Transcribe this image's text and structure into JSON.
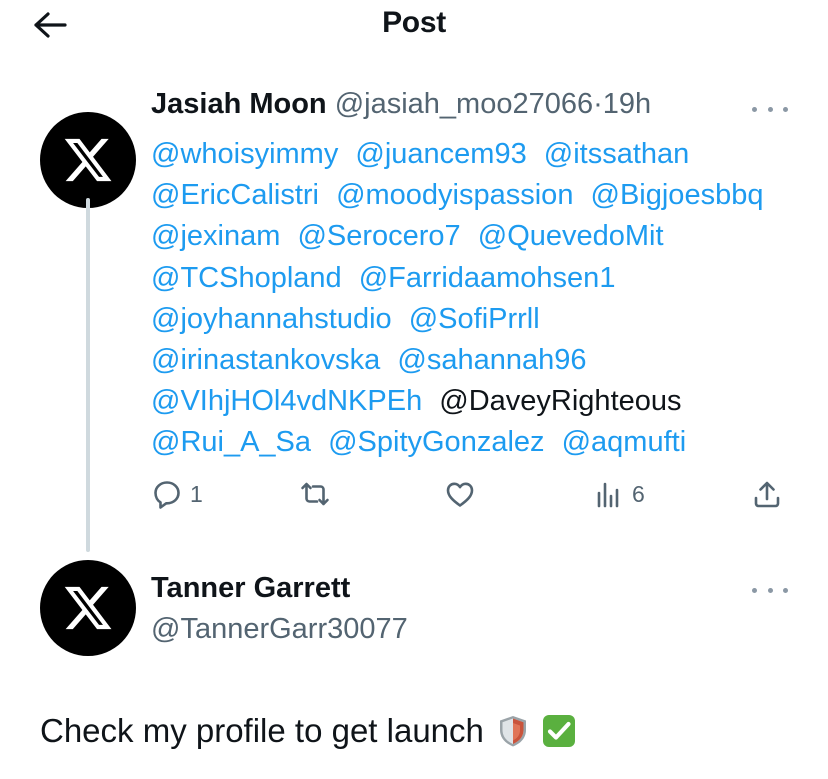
{
  "header": {
    "title": "Post",
    "back_icon": "arrow-left-icon"
  },
  "tweet1": {
    "avatar_icon": "x-logo-icon",
    "name": "Jasiah Moon",
    "handle": "@jasiah_moo27066",
    "separator": "·",
    "time": "19h",
    "more_icon": "more-icon",
    "mentions": [
      {
        "text": "@whoisyimmy",
        "linked": true
      },
      {
        "text": "@juancem93",
        "linked": true
      },
      {
        "text": "@itssathan",
        "linked": true
      },
      {
        "text": "@EricCalistri",
        "linked": true
      },
      {
        "text": "@moodyispassion",
        "linked": true
      },
      {
        "text": "@Bigjoesbbq",
        "linked": true
      },
      {
        "text": "@jexinam",
        "linked": true
      },
      {
        "text": "@Serocero7",
        "linked": true
      },
      {
        "text": "@QuevedoMit",
        "linked": true
      },
      {
        "text": "@TCShopland",
        "linked": true
      },
      {
        "text": "@Farridaamohsen1",
        "linked": true
      },
      {
        "text": "@joyhannahstudio",
        "linked": true
      },
      {
        "text": "@SofiPrrll",
        "linked": true
      },
      {
        "text": "@irinastankovska",
        "linked": true
      },
      {
        "text": "@sahannah96",
        "linked": true
      },
      {
        "text": "@VIhjHOl4vdNKPEh",
        "linked": true
      },
      {
        "text": "@DaveyRighteous",
        "linked": false
      },
      {
        "text": "@Rui_A_Sa",
        "linked": true
      },
      {
        "text": "@SpityGonzalez",
        "linked": true
      },
      {
        "text": "@aqmufti",
        "linked": true
      }
    ],
    "actions": {
      "reply_count": "1",
      "retweet_count": "",
      "like_count": "",
      "views_count": "6"
    }
  },
  "tweet2": {
    "avatar_icon": "x-logo-icon",
    "name": "Tanner Garrett",
    "handle": "@TannerGarr30077",
    "more_icon": "more-icon",
    "body": "Check my profile to get launch",
    "emojis": [
      "shield-emoji",
      "check-mark-button-emoji"
    ]
  },
  "colors": {
    "link": "#1d9bf0",
    "text": "#0f1419",
    "secondary": "#536471",
    "thread_line": "#cfd9de",
    "emoji_check": "#5ab03f",
    "emoji_shield": "#c9543c"
  }
}
